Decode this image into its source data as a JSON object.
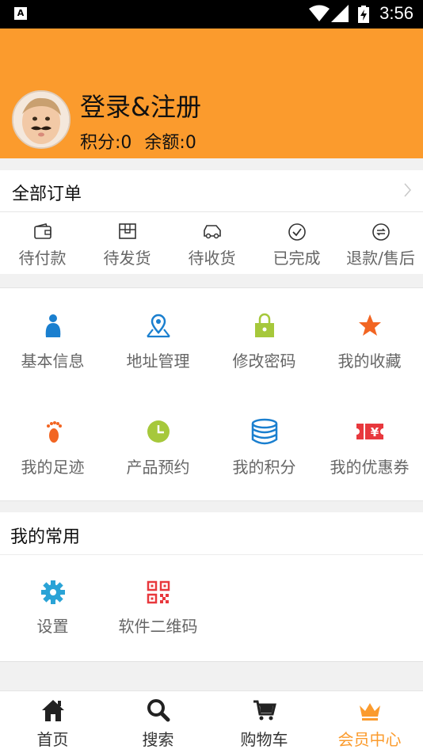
{
  "status_bar": {
    "time": "3:56",
    "notification_icon": "A"
  },
  "profile": {
    "login_label": "登录&注册",
    "points_label": "积分:0",
    "balance_label": "余额:0"
  },
  "orders": {
    "title": "全部订单",
    "items": [
      {
        "label": "待付款",
        "icon": "wallet-icon"
      },
      {
        "label": "待发货",
        "icon": "package-icon"
      },
      {
        "label": "待收货",
        "icon": "truck-icon"
      },
      {
        "label": "已完成",
        "icon": "check-circle-icon"
      },
      {
        "label": "退款/售后",
        "icon": "refund-icon"
      }
    ]
  },
  "features": {
    "items": [
      {
        "label": "基本信息",
        "icon": "person-icon",
        "color": "#1a7fcf"
      },
      {
        "label": "地址管理",
        "icon": "location-pin-icon",
        "color": "#1a7fcf"
      },
      {
        "label": "修改密码",
        "icon": "lock-icon",
        "color": "#a6c83b"
      },
      {
        "label": "我的收藏",
        "icon": "star-icon",
        "color": "#f26522"
      },
      {
        "label": "我的足迹",
        "icon": "footprint-icon",
        "color": "#f26522"
      },
      {
        "label": "产品预约",
        "icon": "clock-icon",
        "color": "#a6c83b"
      },
      {
        "label": "我的积分",
        "icon": "database-icon",
        "color": "#1a7fcf"
      },
      {
        "label": "我的优惠券",
        "icon": "coupon-icon",
        "color": "#e8383d",
        "coupon_text": "¥"
      }
    ]
  },
  "common": {
    "title": "我的常用",
    "items": [
      {
        "label": "设置",
        "icon": "gear-icon",
        "color": "#2aa3d6"
      },
      {
        "label": "软件二维码",
        "icon": "qr-code-icon",
        "color": "#e8383d"
      }
    ]
  },
  "tabbar": {
    "items": [
      {
        "label": "首页",
        "icon": "home-icon"
      },
      {
        "label": "搜索",
        "icon": "search-icon"
      },
      {
        "label": "购物车",
        "icon": "cart-icon"
      },
      {
        "label": "会员中心",
        "icon": "crown-icon"
      }
    ],
    "active_index": 3,
    "active_color": "#fb9b2d"
  }
}
